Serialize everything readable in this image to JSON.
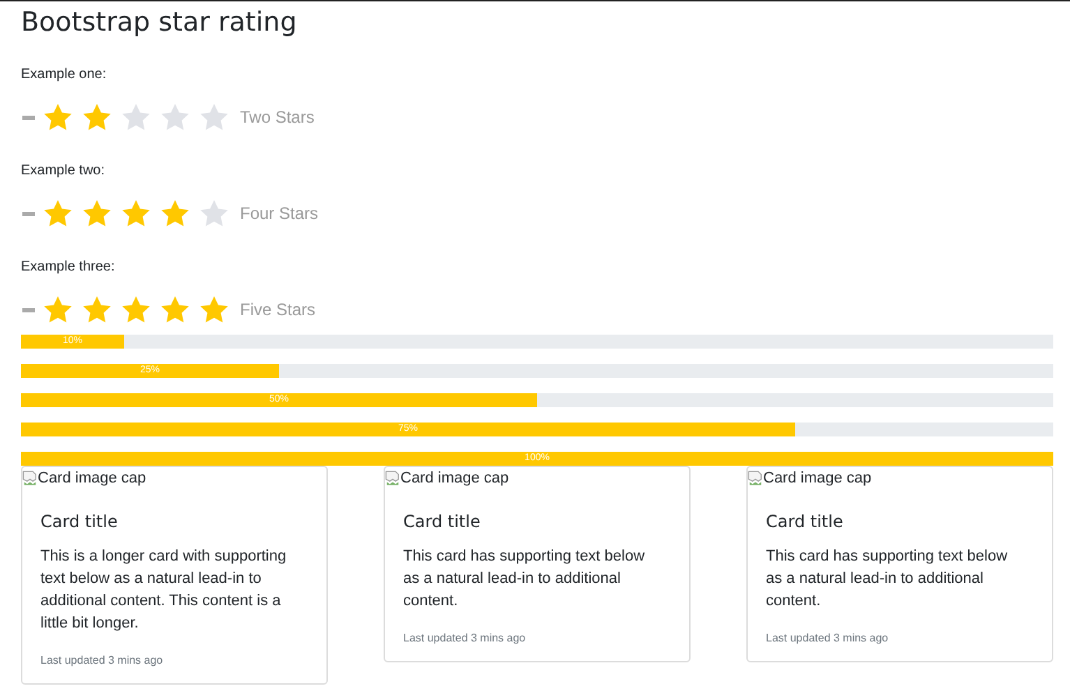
{
  "title": "Bootstrap star rating",
  "ratings": [
    {
      "label": "Example one:",
      "stars": 2,
      "caption": "Two Stars"
    },
    {
      "label": "Example two:",
      "stars": 4,
      "caption": "Four Stars"
    },
    {
      "label": "Example three:",
      "stars": 5,
      "caption": "Five Stars"
    }
  ],
  "progress_bars": [
    {
      "level": 0.1,
      "label": "10%"
    },
    {
      "level": 0.25,
      "label": "25%"
    },
    {
      "level": 0.5,
      "label": "50%"
    },
    {
      "level": 0.75,
      "label": "75%"
    },
    {
      "level": 1,
      "label": "100%"
    }
  ],
  "cards": [
    {
      "image_alt": "Card image cap",
      "title": "Card title",
      "text": "This is a longer card with supporting text below as a natural lead-in to additional content. This content is a little bit longer.",
      "footer": "Last updated 3 mins ago"
    },
    {
      "image_alt": "Card image cap",
      "title": "Card title",
      "text": "This card has supporting text below as a natural lead-in to additional content.",
      "footer": "Last updated 3 mins ago"
    },
    {
      "image_alt": "Card image cap",
      "title": "Card title",
      "text": "This card has supporting text below as a natural lead-in to additional content.",
      "footer": "Last updated 3 mins ago"
    }
  ]
}
